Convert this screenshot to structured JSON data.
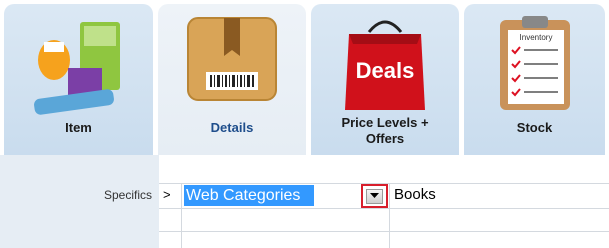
{
  "tabs": [
    {
      "label": "Item",
      "icon": "products-icon",
      "active": false
    },
    {
      "label": "Details",
      "icon": "box-icon",
      "active": true
    },
    {
      "label": "Price Levels +\nOffers",
      "icon": "deals-bag-icon",
      "active": false
    },
    {
      "label": "Stock",
      "icon": "inventory-clipboard-icon",
      "active": false
    }
  ],
  "icon_text": {
    "deals": "Deals",
    "inventory": "Inventory"
  },
  "details": {
    "label": "Specifics",
    "row_marker": ">",
    "field_value": "Web Categories",
    "selected_value": "Books"
  },
  "colors": {
    "selection": "#3399ff",
    "highlight_border": "#d81e2c",
    "active_tab_text": "#1f4e8c"
  }
}
